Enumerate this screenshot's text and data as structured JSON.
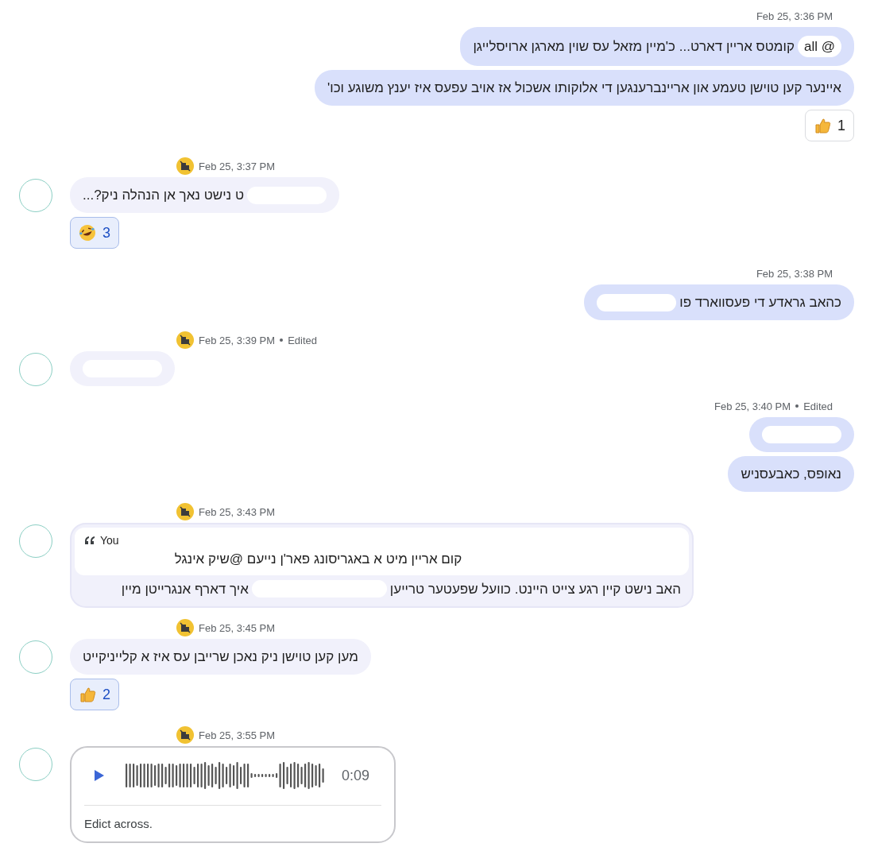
{
  "messages": [
    {
      "kind": "outgoing",
      "time": "Feb 25, 3:36 PM",
      "edited": false,
      "bubbles": [
        {
          "mention": {
            "symbol": "@",
            "label": "all"
          },
          "parts": [
            {
              "kind": "text",
              "text": "קומטס אריין דארט... כ'מיין מזאל עס שוין מארגן ארויסלייגן"
            }
          ]
        },
        {
          "parts": [
            {
              "kind": "text",
              "text": "איינער קען טוישן טעמע און אריינברענגען די אלוקותו אשכול אז אויב עפעס איז יענץ משוגע וכו'"
            }
          ]
        }
      ],
      "reactions": [
        {
          "kind": "thumbs-up",
          "count": "1",
          "selected": false
        }
      ]
    },
    {
      "kind": "incoming",
      "time": "Feb 25, 3:37 PM",
      "edited": false,
      "bubbles": [
        {
          "parts": [
            {
              "kind": "redaction"
            },
            {
              "kind": "text",
              "text": "ט נישט נאך אן הנהלה ניק?..."
            }
          ]
        }
      ],
      "reactions": [
        {
          "kind": "laughing",
          "count": "3",
          "selected": true
        }
      ]
    },
    {
      "kind": "outgoing",
      "time": "Feb 25, 3:38 PM",
      "edited": false,
      "bubbles": [
        {
          "parts": [
            {
              "kind": "text",
              "text": "כהאב גראדע די פעסווארד פו"
            },
            {
              "kind": "redaction"
            }
          ]
        }
      ]
    },
    {
      "kind": "incoming",
      "time": "Feb 25, 3:39 PM",
      "edited": true,
      "edited_label": "Edited",
      "bubbles": [
        {
          "parts": [
            {
              "kind": "redaction"
            }
          ]
        }
      ]
    },
    {
      "kind": "outgoing",
      "time": "Feb 25, 3:40 PM",
      "edited": true,
      "edited_label": "Edited",
      "bubbles": [
        {
          "parts": [
            {
              "kind": "redaction"
            }
          ]
        },
        {
          "parts": [
            {
              "kind": "text",
              "text": "נאופס, כאבעסניש"
            }
          ]
        }
      ]
    },
    {
      "kind": "incoming",
      "time": "Feb 25, 3:43 PM",
      "edited": false,
      "quote": {
        "author": "You",
        "text": "קום אריין מיט א באגריסונג פאר'ן נייעם @שיק אינגל"
      },
      "bubbles": [
        {
          "parts": [
            {
              "kind": "text",
              "text": "האב נישט קיין רגע צייט היינט. כוועל שפעטער טרייען"
            },
            {
              "kind": "redaction"
            },
            {
              "kind": "text",
              "text": "איך דארף אנגרייטן מיין"
            }
          ]
        }
      ]
    },
    {
      "kind": "incoming",
      "time": "Feb 25, 3:45 PM",
      "edited": false,
      "bubbles": [
        {
          "parts": [
            {
              "kind": "text",
              "text": "מען קען טוישן ניק נאכן שרייבן עס איז א קלייניקייט"
            }
          ]
        }
      ],
      "reactions": [
        {
          "kind": "thumbs-up",
          "count": "2",
          "selected": true
        }
      ]
    },
    {
      "kind": "incoming",
      "time": "Feb 25, 3:55 PM",
      "edited": false,
      "audio": {
        "duration": "0:09",
        "caption": "Edict across."
      }
    }
  ]
}
